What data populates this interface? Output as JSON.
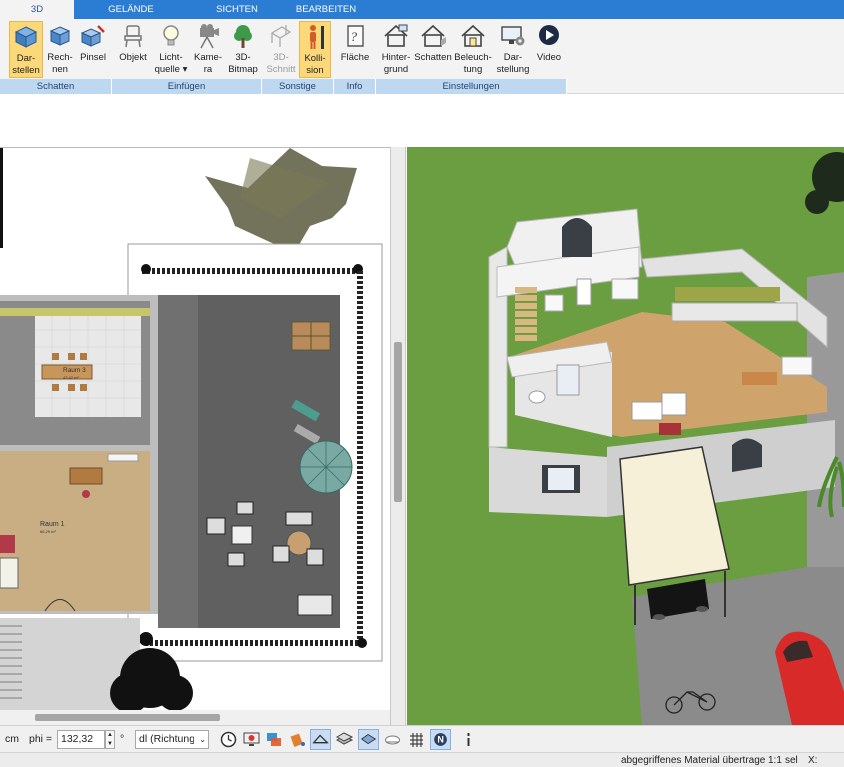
{
  "tabs": [
    {
      "label": "3D",
      "active": true
    },
    {
      "label": "GELÄNDE",
      "active": false
    },
    {
      "label": "SICHTEN",
      "active": false
    },
    {
      "label": "BEARBEITEN",
      "active": false
    }
  ],
  "ribbon": {
    "buttons": [
      {
        "l1": "Dar-",
        "l2": "stellen",
        "icon": "cube-solid-icon",
        "selected": true
      },
      {
        "l1": "Rech-",
        "l2": "nen",
        "icon": "cube-render-icon"
      },
      {
        "l1": "Pinsel",
        "l2": "",
        "icon": "cube-brush-icon"
      },
      {
        "l1": "Objekt",
        "l2": "",
        "icon": "chair-icon"
      },
      {
        "l1": "Licht-",
        "l2": "quelle ▾",
        "icon": "bulb-icon"
      },
      {
        "l1": "Kame-",
        "l2": "ra",
        "icon": "camera-icon"
      },
      {
        "l1": "3D-",
        "l2": "Bitmap",
        "icon": "tree-icon"
      },
      {
        "l1": "3D-",
        "l2": "Schnitt",
        "icon": "section-icon",
        "disabled": true
      },
      {
        "l1": "Kolli-",
        "l2": "sion",
        "icon": "person-icon",
        "selected": true
      },
      {
        "l1": "Fläche",
        "l2": "",
        "icon": "area-icon"
      },
      {
        "l1": "Hinter-",
        "l2": "grund",
        "icon": "house-background-icon"
      },
      {
        "l1": "Schatten",
        "l2": "",
        "icon": "house-shadow-icon"
      },
      {
        "l1": "Beleuch-",
        "l2": "tung",
        "icon": "house-light-icon"
      },
      {
        "l1": "Dar-",
        "l2": "stellung",
        "icon": "monitor-gear-icon"
      },
      {
        "l1": "Video",
        "l2": "",
        "icon": "play-icon"
      }
    ],
    "groups": [
      "Schatten",
      "Einfügen",
      "Sonstige",
      "Info",
      "Einstellungen"
    ]
  },
  "plan": {
    "room1_name": "Raum 1",
    "room1_area": "66,29 m²",
    "room3_name": "Raum 3",
    "room3_area": "43,42 m²"
  },
  "toolbar": {
    "unit_label": "cm",
    "phi_label": "phi =",
    "phi_value": "132,32",
    "degree_symbol": "°",
    "dl_value": "dl (Richtung/Di",
    "icons": [
      "clock-icon",
      "monitor-red-icon",
      "layers-icon",
      "paint-bucket-icon",
      "plane-view-icon",
      "walls-view-icon",
      "flat-view-icon",
      "cloud-view-icon",
      "grid-icon",
      "north-icon",
      "pin-icon"
    ]
  },
  "status": {
    "message": "abgegriffenes Material übertrage",
    "scale": "1:1",
    "sel": "sel",
    "x_label": "X:"
  },
  "colors": {
    "tab_blue": "#2b7cd3",
    "ribbon_bg": "#f3f3f3",
    "group_bg": "#bfd8f2",
    "selected": "#fbd87a",
    "grass": "#6a9e40"
  }
}
